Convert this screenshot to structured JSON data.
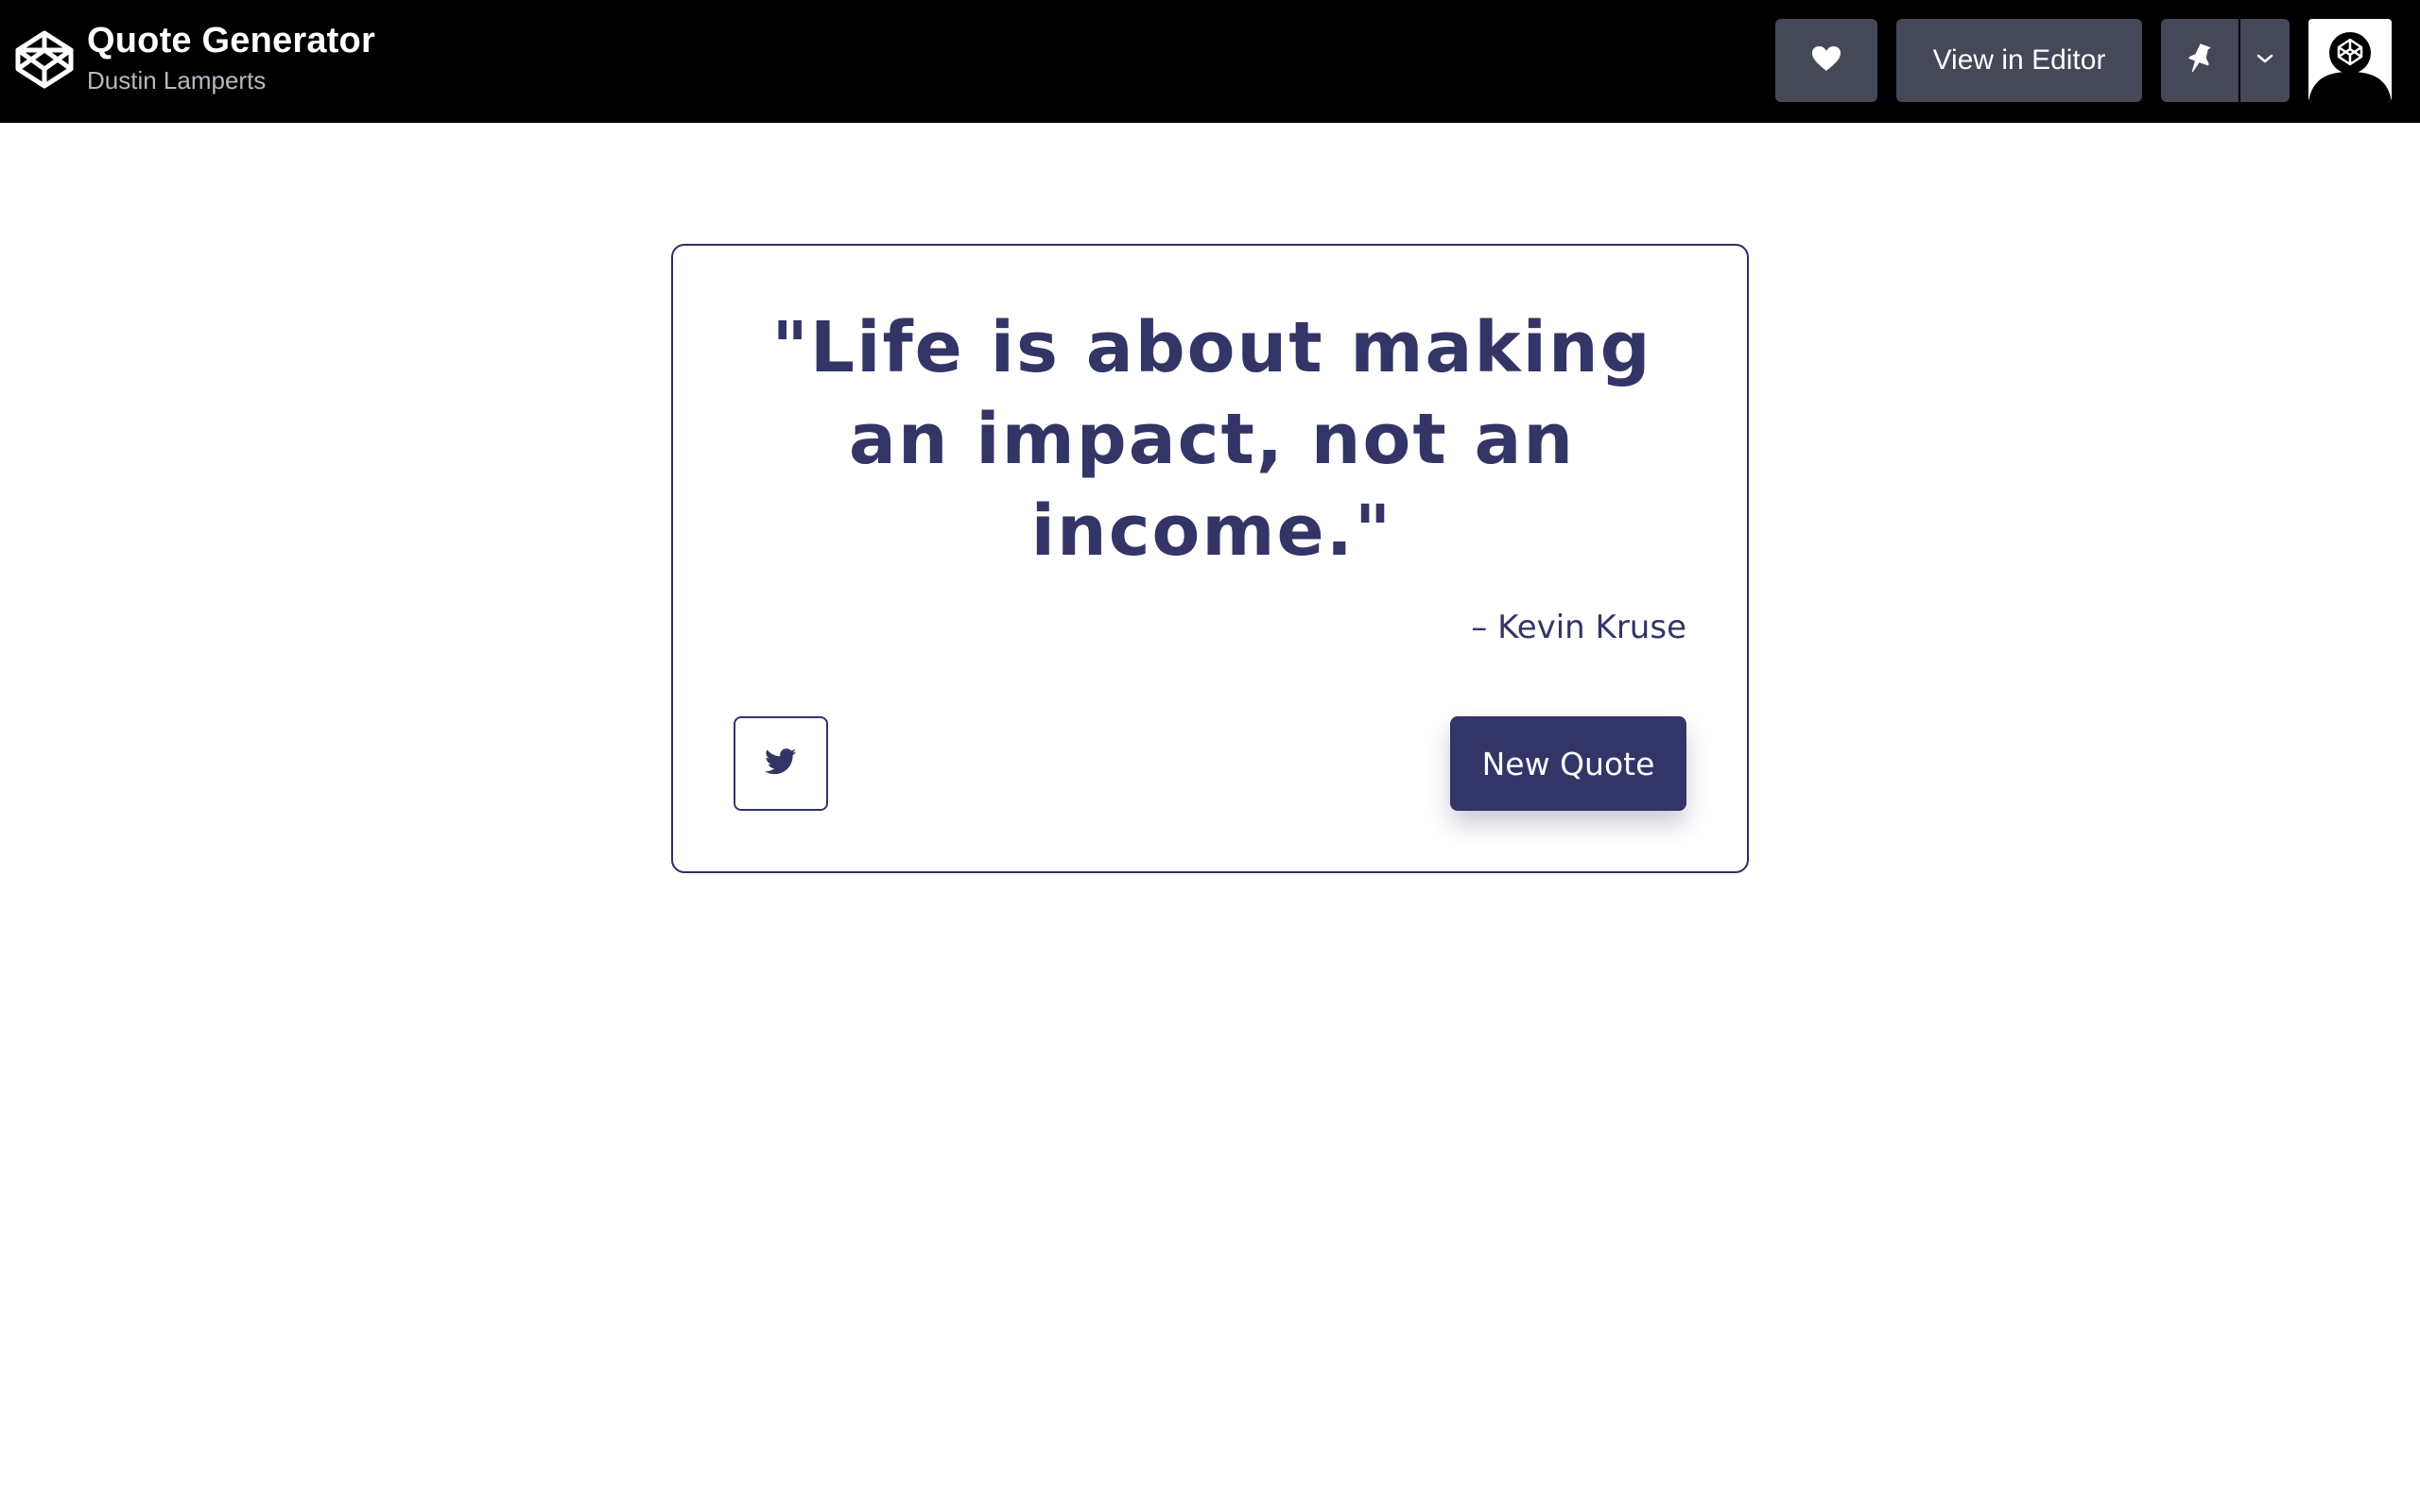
{
  "header": {
    "title": "Quote Generator",
    "author": "Dustin Lamperts",
    "view_in_editor_label": "View in Editor",
    "icons": {
      "logo": "codepen-logo-icon",
      "heart": "heart-icon",
      "pin": "pin-icon",
      "caret": "chevron-down-icon",
      "avatar": "user-avatar"
    }
  },
  "card": {
    "quote": "\"Life is about making an impact, not an income.\"",
    "author": "– Kevin Kruse",
    "new_quote_label": "New Quote",
    "tweet_icon": "twitter-icon"
  },
  "colors": {
    "topbar_bg": "#000000",
    "button_bg": "#444857",
    "accent": "#333566",
    "card_border": "#2e2f5e"
  }
}
